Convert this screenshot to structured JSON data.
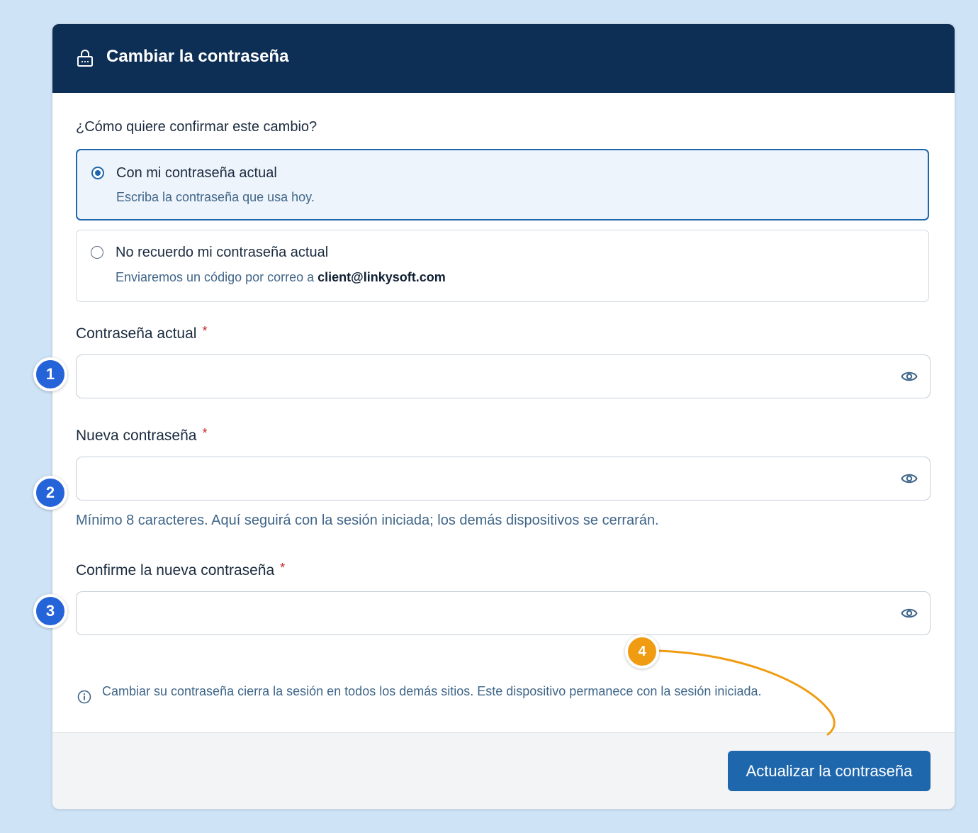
{
  "header": {
    "title": "Cambiar la contraseña",
    "icon": "lock-icon"
  },
  "confirm": {
    "question": "¿Cómo quiere confirmar este cambio?",
    "options": [
      {
        "title": "Con mi contraseña actual",
        "description": "Escriba la contraseña que usa hoy.",
        "selected": true
      },
      {
        "title": "No recuerdo mi contraseña actual",
        "description_prefix": "Enviaremos un código por correo a ",
        "email": "client@linkysoft.com",
        "selected": false
      }
    ]
  },
  "fields": {
    "current": {
      "label": "Contraseña actual",
      "required_mark": "*",
      "value": ""
    },
    "new": {
      "label": "Nueva contraseña",
      "required_mark": "*",
      "value": "",
      "hint": "Mínimo 8 caracteres. Aquí seguirá con la sesión iniciada; los demás dispositivos se cerrarán."
    },
    "confirm": {
      "label": "Confirme la nueva contraseña",
      "required_mark": "*",
      "value": ""
    }
  },
  "info": {
    "icon": "info-icon",
    "text": "Cambiar su contraseña cierra la sesión en todos los demás sitios. Este dispositivo permanece con la sesión iniciada."
  },
  "footer": {
    "submit_label": "Actualizar la contraseña"
  },
  "annotations": {
    "badges": [
      "1",
      "2",
      "3",
      "4"
    ],
    "step_color": "#2563d8",
    "action_color": "#f09c12"
  },
  "colors": {
    "header_bg": "#0e2f55",
    "primary": "#1f67ad",
    "page_bg": "#cfe3f7",
    "required": "#c62828"
  }
}
